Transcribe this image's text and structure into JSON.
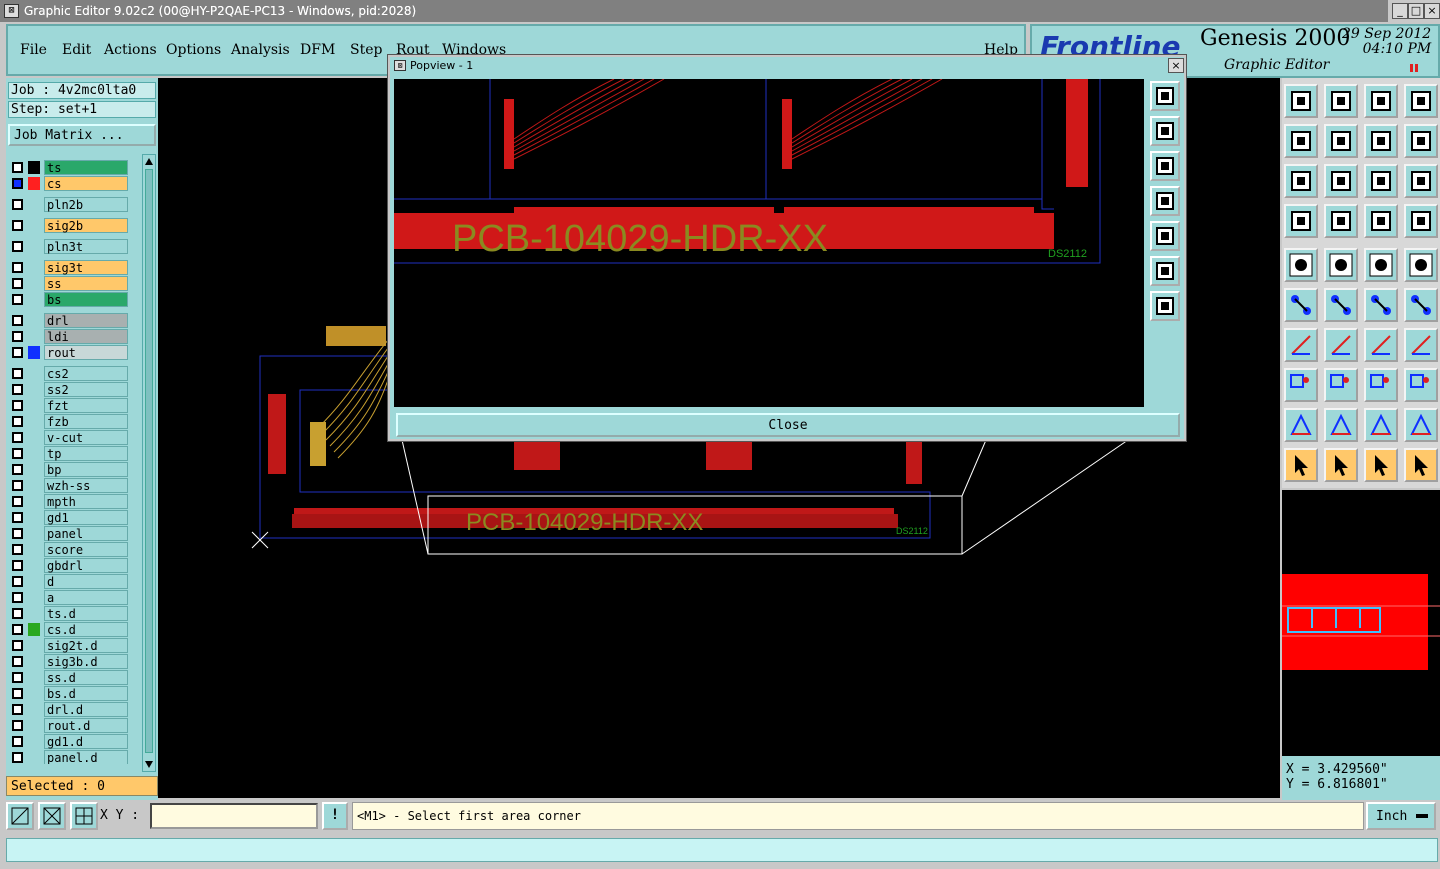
{
  "window": {
    "title": "Graphic Editor 9.02c2 (00@HY-P2QAE-PC13 - Windows, pid:2028)",
    "controls": [
      "_",
      "□",
      "×"
    ]
  },
  "menu": {
    "items": [
      "File",
      "Edit",
      "Actions",
      "Options",
      "Analysis",
      "DFM",
      "Step",
      "Rout",
      "Windows"
    ],
    "help": "Help"
  },
  "brand": {
    "logo": "Frontline",
    "product": "Genesis 2000",
    "subtitle": "Graphic Editor",
    "date": "29 Sep 2012",
    "time": "04:10 PM"
  },
  "job": {
    "job_label": "Job : 4v2mc0lta0",
    "step_label": "Step: set+1",
    "matrix_button": "Job Matrix ..."
  },
  "layers": [
    {
      "name": "ts",
      "color": "#2aa86a",
      "swatch": "#000000"
    },
    {
      "name": "cs",
      "color": "#ffc86a",
      "swatch": "#ff2020",
      "active": true
    },
    {
      "name": "pln2b",
      "color": "#9ed8d8",
      "swatch": ""
    },
    {
      "name": "sig2b",
      "color": "#ffc86a",
      "swatch": ""
    },
    {
      "name": "pln3t",
      "color": "#9ed8d8",
      "swatch": ""
    },
    {
      "name": "sig3t",
      "color": "#ffc86a",
      "swatch": ""
    },
    {
      "name": "ss",
      "color": "#ffc86a",
      "swatch": ""
    },
    {
      "name": "bs",
      "color": "#2aa86a",
      "swatch": ""
    },
    {
      "name": "drl",
      "color": "#a8b0b0",
      "swatch": ""
    },
    {
      "name": "ldi",
      "color": "#a8b0b0",
      "swatch": ""
    },
    {
      "name": "rout",
      "color": "#c8d8d8",
      "swatch": "#1030ff"
    },
    {
      "name": "cs2",
      "color": "#9ed8d8",
      "swatch": ""
    },
    {
      "name": "ss2",
      "color": "#9ed8d8",
      "swatch": ""
    },
    {
      "name": "fzt",
      "color": "#9ed8d8",
      "swatch": ""
    },
    {
      "name": "fzb",
      "color": "#9ed8d8",
      "swatch": ""
    },
    {
      "name": "v-cut",
      "color": "#9ed8d8",
      "swatch": ""
    },
    {
      "name": "tp",
      "color": "#9ed8d8",
      "swatch": ""
    },
    {
      "name": "bp",
      "color": "#9ed8d8",
      "swatch": ""
    },
    {
      "name": "wzh-ss",
      "color": "#9ed8d8",
      "swatch": ""
    },
    {
      "name": "mpth",
      "color": "#9ed8d8",
      "swatch": ""
    },
    {
      "name": "gd1",
      "color": "#9ed8d8",
      "swatch": ""
    },
    {
      "name": "panel",
      "color": "#9ed8d8",
      "swatch": ""
    },
    {
      "name": "score",
      "color": "#9ed8d8",
      "swatch": ""
    },
    {
      "name": "gbdrl",
      "color": "#9ed8d8",
      "swatch": ""
    },
    {
      "name": "d",
      "color": "#9ed8d8",
      "swatch": ""
    },
    {
      "name": "a",
      "color": "#9ed8d8",
      "swatch": ""
    },
    {
      "name": "ts.d",
      "color": "#9ed8d8",
      "swatch": ""
    },
    {
      "name": "cs.d",
      "color": "#9ed8d8",
      "swatch": "#2aa820"
    },
    {
      "name": "sig2t.d",
      "color": "#9ed8d8",
      "swatch": ""
    },
    {
      "name": "sig3b.d",
      "color": "#9ed8d8",
      "swatch": ""
    },
    {
      "name": "ss.d",
      "color": "#9ed8d8",
      "swatch": ""
    },
    {
      "name": "bs.d",
      "color": "#9ed8d8",
      "swatch": ""
    },
    {
      "name": "drl.d",
      "color": "#9ed8d8",
      "swatch": ""
    },
    {
      "name": "rout.d",
      "color": "#9ed8d8",
      "swatch": ""
    },
    {
      "name": "gd1.d",
      "color": "#9ed8d8",
      "swatch": ""
    },
    {
      "name": "panel.d",
      "color": "#9ed8d8",
      "swatch": ""
    }
  ],
  "selected": "Selected : 0",
  "popview": {
    "title": "Popview - 1",
    "close_label": "Close",
    "pcb_label": "PCB-104029-HDR-XX",
    "code_label": "DS2112"
  },
  "main_canvas": {
    "pcb_label": "PCB-104029-HDR-XX",
    "code_label": "DS2112"
  },
  "coords": {
    "x": "X = 3.429560\"",
    "y": "Y = 6.816801\""
  },
  "status": {
    "xy_label": "X Y :",
    "xy_value": "",
    "prompt": "<M1> - Select first area corner",
    "units": "Inch"
  },
  "colors": {
    "panel_bg": "#9ed8d8",
    "accent_orange": "#ffc86a",
    "canvas": "#000000",
    "pcb_red": "#e01818",
    "label_olive": "#8a8a20"
  }
}
